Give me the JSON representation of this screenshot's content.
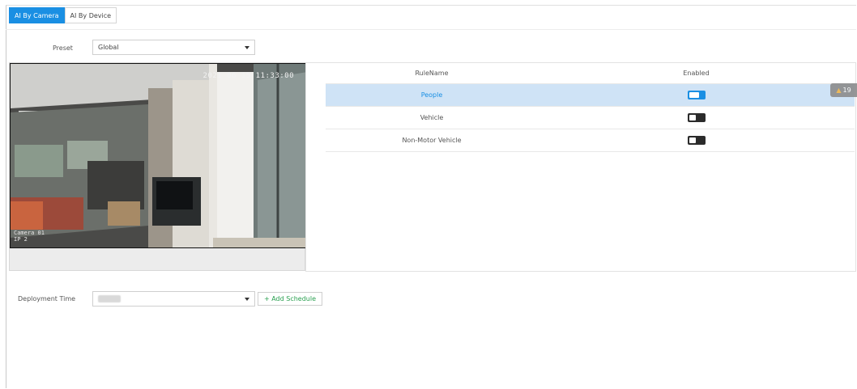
{
  "tabs": [
    {
      "label": "AI By Camera",
      "active": true
    },
    {
      "label": "AI By Device",
      "active": false
    }
  ],
  "preset": {
    "label": "Preset",
    "value": "Global"
  },
  "video": {
    "timestamp": "2021 06 15 11:33:00",
    "channel_line1": "Camera 01",
    "channel_line2": "IP 2"
  },
  "rules": {
    "headers": {
      "name": "RuleName",
      "enabled": "Enabled"
    },
    "rows": [
      {
        "name": "People",
        "enabled": true,
        "selected": true
      },
      {
        "name": "Vehicle",
        "enabled": false,
        "selected": false
      },
      {
        "name": "Non-Motor Vehicle",
        "enabled": false,
        "selected": false
      }
    ]
  },
  "alarm_badge": {
    "count": "19",
    "icon": "warning-icon"
  },
  "deployment": {
    "label": "Deployment Time",
    "value": "",
    "add_schedule": "+ Add Schedule"
  },
  "colors": {
    "accent": "#1a8fe3",
    "selected_row": "#cfe3f6",
    "add_green": "#2aa050"
  }
}
